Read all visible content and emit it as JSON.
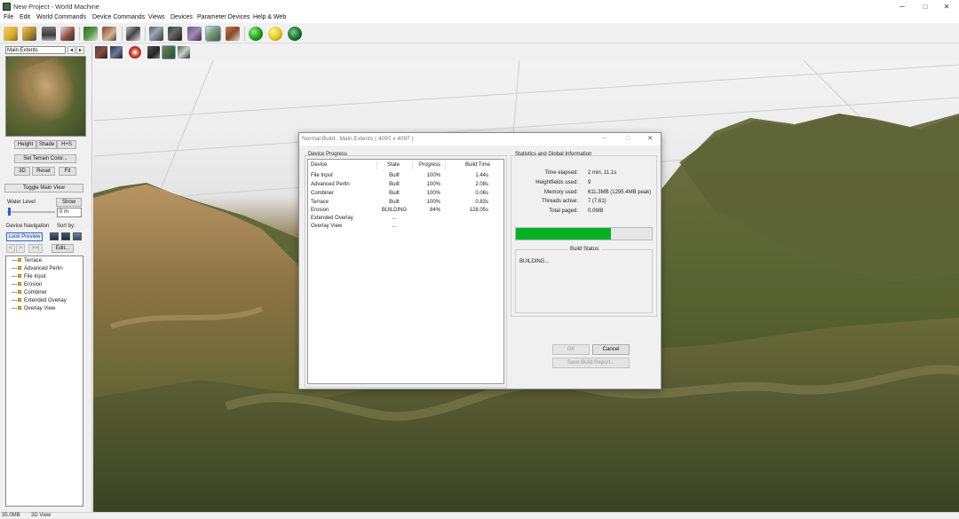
{
  "window": {
    "title": "New Project - World Machine",
    "controls": {
      "minimize": "─",
      "maximize": "□",
      "close": "✕"
    }
  },
  "menu": [
    "File",
    "Edit",
    "World Commands",
    "Device Commands",
    "Views",
    "Devices",
    "Parameter Devices",
    "Help & Web"
  ],
  "toolbar_icons": [
    "new-project-icon",
    "open-project-icon",
    "save-project-icon",
    "project-settings-icon",
    "terrain-wizard-icon",
    "build-icon",
    "device-layout-icon",
    "layout-view-icon",
    "heightfield-view-icon",
    "texture-view-icon",
    "3d-view-icon",
    "device-view-icon",
    "green-ball-icon",
    "yellow-ball-icon",
    "globe-icon"
  ],
  "view_toolbar_icons": [
    "full-render-icon",
    "quick-render-icon",
    "camera-icon",
    "cube-icon",
    "line-tool-icon",
    "settings-tool-icon"
  ],
  "left_panel": {
    "extent": "Main Extents",
    "arrows": [
      "◂",
      "▸"
    ],
    "buttons_row1": [
      "Height",
      "Shade",
      "H+S"
    ],
    "set_terrain_color": "Set Terrain Color...",
    "buttons_row2": [
      "3D",
      "Reset",
      "Fit"
    ],
    "toggle_main_view": "Toggle Main View",
    "water_level_label": "Water Level",
    "water_show": "Show",
    "water_value": "0 m",
    "device_navigation_label": "Device Navigation",
    "sort_by_label": "Sort by:",
    "look_preview": "Look Preview",
    "nav_buttons": [
      "<",
      ">",
      ">>|"
    ],
    "edit": "Edit...",
    "devices": [
      "Terrace",
      "Advanced Perlin",
      "File Input",
      "Erosion",
      "Combiner",
      "Extended Overlay",
      "Overlay View"
    ]
  },
  "status_bar": {
    "memory": "35.0MB",
    "view": "3D View"
  },
  "dialog": {
    "title": "Normal Build : Main Extents ( 4097 x 4097 )",
    "device_progress_label": "Device Progress",
    "columns": [
      "Device",
      "State",
      "Progress",
      "Build Time"
    ],
    "rows": [
      {
        "device": "File Input",
        "state": "Built",
        "progress": "100%",
        "time": "1.44s"
      },
      {
        "device": "Advanced Perlin",
        "state": "Built",
        "progress": "100%",
        "time": "2.08s"
      },
      {
        "device": "Combiner",
        "state": "Built",
        "progress": "100%",
        "time": "0.06s"
      },
      {
        "device": "Terrace",
        "state": "Built",
        "progress": "100%",
        "time": "0.83s"
      },
      {
        "device": "Erosion",
        "state": "BUILDING",
        "progress": "84%",
        "time": "128.05s"
      },
      {
        "device": "Extended Overlay",
        "state": "...",
        "progress": "",
        "time": ""
      },
      {
        "device": "Overlay View",
        "state": "...",
        "progress": "",
        "time": ""
      }
    ],
    "stats_label": "Statistics and Global Information",
    "stats": [
      {
        "label": "Time elapsed:",
        "value": "2 min, 11.1s"
      },
      {
        "label": "Heightfields used:",
        "value": "9"
      },
      {
        "label": "Memory used:",
        "value": "611.3MB (1295.4MB peak)"
      },
      {
        "label": "Threads active:",
        "value": "7 (7.61)"
      },
      {
        "label": "Total paged:",
        "value": "0.0MB"
      }
    ],
    "overall_progress": 0.7,
    "build_status_label": "Build Status:",
    "build_status_text": "BUILDING...",
    "ok": "OK",
    "cancel": "Cancel",
    "save_report": "Save Build Report..."
  },
  "colors": {
    "progress_green": "#06b025",
    "selection_blue": "#cde0f5",
    "accent_blue": "#2a62c9"
  }
}
